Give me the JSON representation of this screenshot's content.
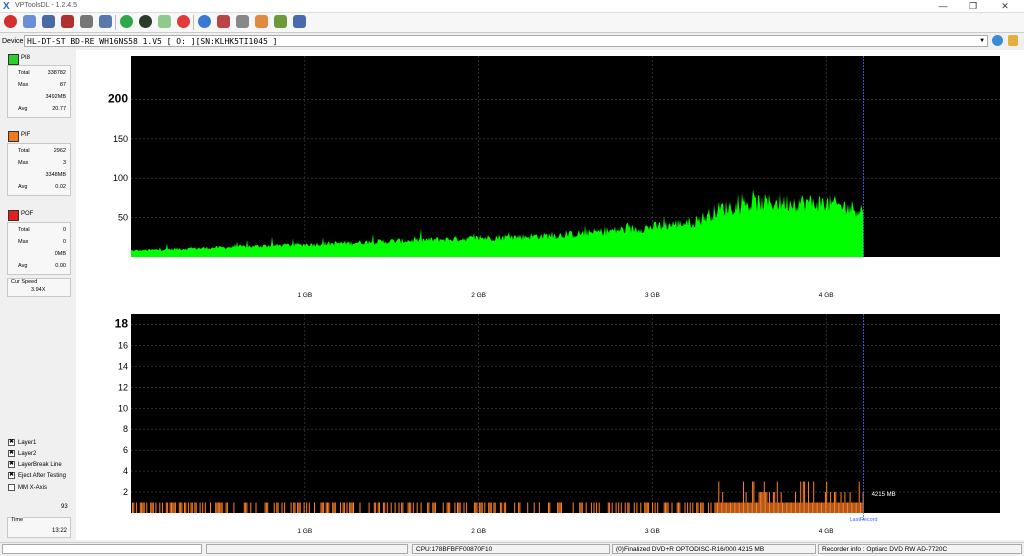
{
  "window": {
    "title": "VPToolsDL - 1.2.4.5"
  },
  "toolbar": {
    "icons": [
      "power-icon",
      "scan-icon",
      "drive-icon",
      "eject-icon",
      "erase-icon",
      "burn-icon",
      "refresh-icon",
      "disc-icon",
      "verify-icon",
      "stop-icon",
      "info-icon",
      "reader-icon",
      "print-icon",
      "hand-icon",
      "chart-icon",
      "save-icon"
    ]
  },
  "device": {
    "label": "Device:",
    "value": "HL-DT-ST BD-RE  WH16NS58  1.V5 [ O: ][SN:KLHK5TI1045 ]"
  },
  "pi8": {
    "label": "PI8",
    "color": "#2ecc2e",
    "total_k": "Total",
    "total": "338782",
    "max_k": "Max",
    "max": "87",
    "mb": "3492MB",
    "avg_k": "Avg",
    "avg": "20.77"
  },
  "pif": {
    "label": "PIF",
    "color": "#f07a20",
    "total_k": "Total",
    "total": "2962",
    "max_k": "Max",
    "max": "3",
    "mb": "3348MB",
    "avg_k": "Avg",
    "avg": "0.02"
  },
  "pof": {
    "label": "POF",
    "color": "#e02020",
    "total_k": "Total",
    "total": "0",
    "max_k": "Max",
    "max": "0",
    "mb": "0MB",
    "avg_k": "Avg",
    "avg": "0.00"
  },
  "speed": {
    "label": "Cur Speed",
    "value": "3.94X"
  },
  "options": {
    "layer1": "Layer1",
    "layer2": "Layer2",
    "layerbreak": "LayerBreak Line",
    "eject": "Eject After Testing",
    "mmx": "MM X-Axis",
    "count": "93"
  },
  "time": {
    "label": "Time",
    "value": "13:22"
  },
  "status": {
    "cpu": "CPU:178BFBFF00870F10",
    "disc": "(0)Finalized  DVD+R  OPTODISC-R16/000  4215 MB",
    "recorder": "Recorder info : Optiarc   DVD RW AD-7720C"
  },
  "chart_data": [
    {
      "type": "area",
      "series": [
        {
          "name": "PI8",
          "color": "#00ff00"
        }
      ],
      "x_ticks": [
        "1 GB",
        "2 GB",
        "3 GB",
        "4 GB"
      ],
      "y_ticks": [
        "50",
        "100",
        "150",
        "200"
      ],
      "ylim": [
        0,
        255
      ],
      "xlim_mb": [
        0,
        5000
      ],
      "end_mb": 4215,
      "profile_mb": [
        0,
        500,
        1000,
        1500,
        2000,
        2500,
        3000,
        3250,
        3400,
        3600,
        3800,
        4000,
        4215
      ],
      "profile_val": [
        8,
        12,
        16,
        20,
        24,
        28,
        38,
        45,
        62,
        68,
        70,
        68,
        60
      ]
    },
    {
      "type": "bar",
      "series": [
        {
          "name": "PIF",
          "color": "#ff7f27"
        }
      ],
      "x_ticks": [
        "1 GB",
        "2 GB",
        "3 GB",
        "4 GB"
      ],
      "y_ticks": [
        "2",
        "4",
        "6",
        "8",
        "10",
        "12",
        "14",
        "16",
        "18"
      ],
      "ylim": [
        0,
        19
      ],
      "xlim_mb": [
        0,
        5000
      ],
      "end_mb": 4215,
      "end_label": "4215 MB",
      "marker_label": "LastRecord"
    }
  ]
}
